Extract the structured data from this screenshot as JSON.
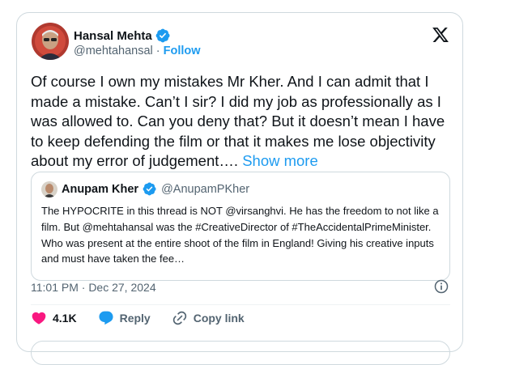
{
  "tweet": {
    "author_name": "Hansal Mehta",
    "author_handle": "@mehtahansal",
    "separator": " · ",
    "follow_label": "Follow",
    "text": "Of course I own my mistakes Mr Kher. And I can admit that I made a mistake. Can’t I sir? I did my job as professionally as I was allowed to. Can you deny that? But it doesn’t mean I have to keep defending the film or that it makes me lose objectivity about my error of judgement…. ",
    "show_more_label": "Show more",
    "timestamp": "11:01 PM · Dec 27, 2024"
  },
  "quote": {
    "author_name": "Anupam Kher",
    "author_handle": "@AnupamPKher",
    "text": "The HYPOCRITE in this thread is NOT @virsanghvi. He has the freedom to not like a film. But @mehtahansal was the #CreativeDirector of #TheAccidentalPrimeMinister. Who was present at the entire shoot of the film in England! Giving his creative inputs and must have taken the fee…"
  },
  "actions": {
    "like_count": "4.1K",
    "reply_label": "Reply",
    "copy_link_label": "Copy link"
  },
  "colors": {
    "accent": "#1d9bf0",
    "like": "#f91880",
    "text": "#0f1419",
    "muted": "#536471",
    "border": "#cfd9de"
  },
  "icons": [
    "verified-badge-icon",
    "x-logo-icon",
    "info-icon",
    "heart-icon",
    "reply-icon",
    "copy-link-icon"
  ]
}
